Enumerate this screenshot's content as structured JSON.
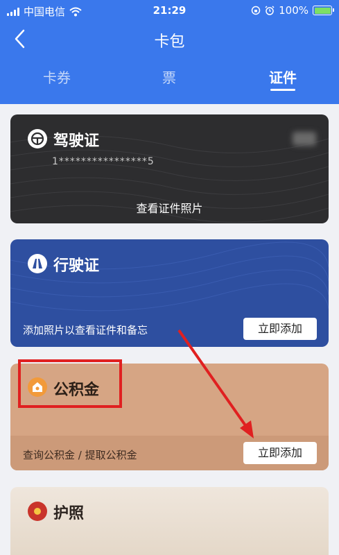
{
  "status": {
    "carrier": "中国电信",
    "time": "21:29",
    "battery": "100%"
  },
  "nav": {
    "title": "卡包"
  },
  "tabs": [
    {
      "label": "卡券"
    },
    {
      "label": "票"
    },
    {
      "label": "证件"
    }
  ],
  "cards": {
    "license": {
      "title": "驾驶证",
      "number": "1****************5",
      "action": "查看证件照片"
    },
    "vehicle": {
      "title": "行驶证",
      "desc": "添加照片以查看证件和备忘",
      "button": "立即添加"
    },
    "fund": {
      "title": "公积金",
      "desc": "查询公积金 / 提取公积金",
      "button": "立即添加"
    },
    "passport": {
      "title": "护照"
    }
  },
  "colors": {
    "header": "#3a78ec",
    "license_card": "#2d2d2f",
    "vehicle_card": "#2e4fa0",
    "fund_card": "#d6a584",
    "annotation": "#e02020"
  }
}
